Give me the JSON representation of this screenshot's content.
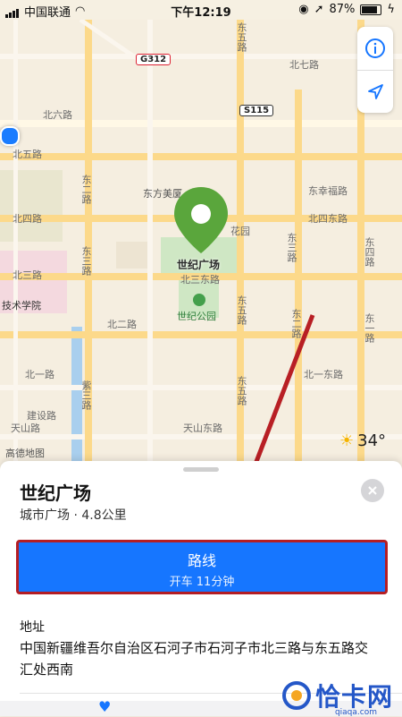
{
  "status_bar": {
    "carrier": "中国联通",
    "time": "下午12:19",
    "battery": "87%"
  },
  "map": {
    "road_labels": {
      "n7": "北七路",
      "n6": "北六路",
      "n5": "北五路",
      "n4": "北四路",
      "n3_left": "北三路",
      "n3_center": "北三东路",
      "n2": "北二路",
      "n1": "北一路",
      "n1_east": "北一东路",
      "n4_east": "北四东路",
      "dongfeng": "东幸福路",
      "e2": "东二路",
      "e3": "东三路",
      "e5a": "东五路",
      "e5b": "东五路",
      "dong5": "东五路",
      "dong4": "东四路",
      "dong3": "东三路",
      "dong2": "东二路",
      "dong1": "东一路",
      "jianshe": "建设路",
      "tianshan": "天山路",
      "tianshan_east": "天山东路",
      "j3": "紫三路",
      "hua": "花园"
    },
    "shields": {
      "g312": "G312",
      "s115": "S115"
    },
    "poi": {
      "plaza": "世纪广场",
      "park": "世纪公园",
      "dongfang": "东方美厦",
      "college": "技术学院"
    },
    "attribution": "高德地图",
    "weather": "34°"
  },
  "sheet": {
    "title": "世纪广场",
    "subtitle": "城市广场 · 4.8公里",
    "route_label": "路线",
    "route_detail": "开车 11分钟",
    "address_label": "地址",
    "address": "中国新疆维吾尔自治区石河子市石河子市北三路与东五路交汇处西南"
  },
  "watermark": {
    "text": "恰卡网",
    "url": "qiaqa.com"
  },
  "colors": {
    "accent": "#1676ff",
    "highlight": "#b41e24",
    "pin": "#5aa63c",
    "arrow": "#b81f24"
  }
}
